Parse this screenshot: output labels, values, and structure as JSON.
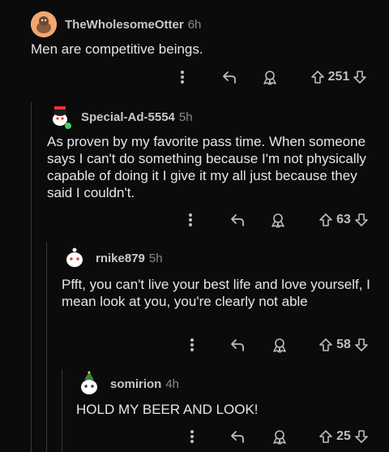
{
  "comments": [
    {
      "user": "TheWholesomeOtter",
      "time": "6h",
      "body": "Men are competitive beings.",
      "score": "251",
      "avatar_color": "#f0a46b"
    },
    {
      "user": "Special-Ad-5554",
      "time": "5h",
      "body": "As proven by my favorite pass time. When someone says I can't do something because I'm not physically capable of doing it I give it my all just because they said I couldn't.",
      "score": "63",
      "avatar_color": "#ffffff"
    },
    {
      "user": "rnike879",
      "time": "5h",
      "body": "Pfft, you can't live your best life and love yourself, I mean look at you, you're clearly not able",
      "score": "58",
      "avatar_color": "#ffffff"
    },
    {
      "user": "somirion",
      "time": "4h",
      "body": "HOLD MY BEER AND LOOK!",
      "score": "25",
      "avatar_color": "#ffffff"
    }
  ],
  "icons": {
    "more": "more-options-icon",
    "reply": "reply-icon",
    "award": "award-icon",
    "upvote": "upvote-icon",
    "downvote": "downvote-icon"
  }
}
